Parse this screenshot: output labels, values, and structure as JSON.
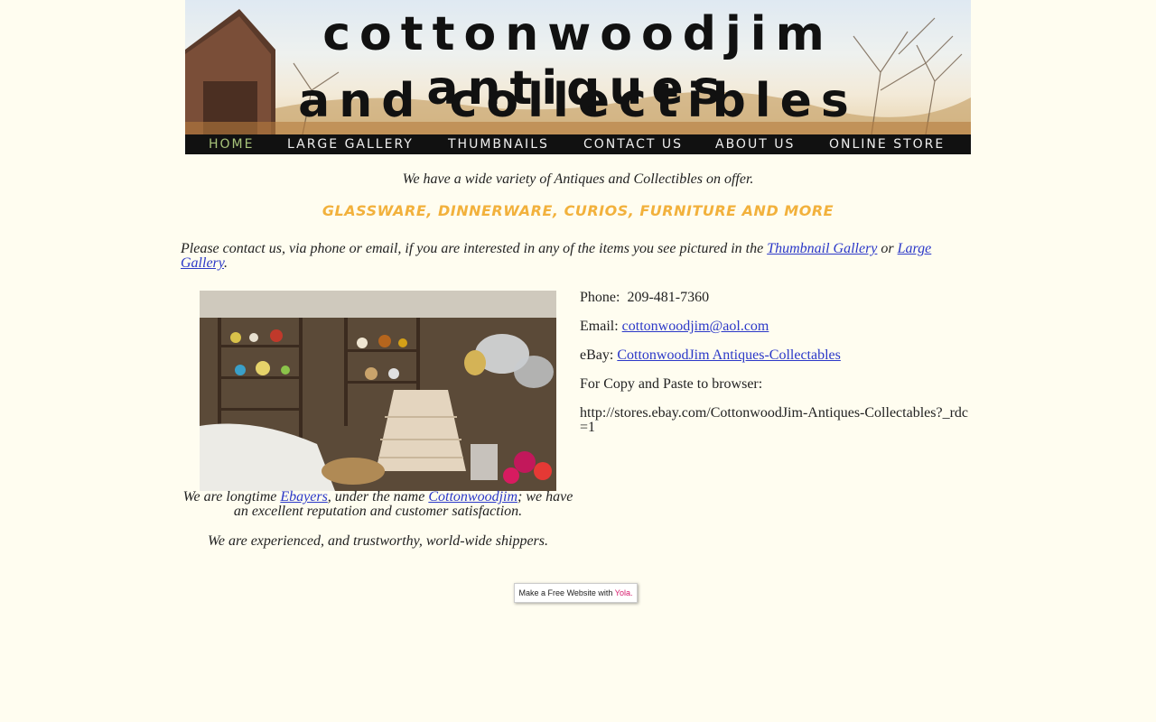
{
  "header": {
    "title_line1": "cottonwoodjim antiques",
    "title_line2": "and collectibles"
  },
  "nav": {
    "items": [
      {
        "label": "HOME",
        "active": true
      },
      {
        "label": "LARGE GALLERY",
        "active": false
      },
      {
        "label": "THUMBNAILS",
        "active": false
      },
      {
        "label": "CONTACT US",
        "active": false
      },
      {
        "label": "ABOUT US",
        "active": false
      },
      {
        "label": "ONLINE STORE",
        "active": false
      }
    ],
    "active_color": "#a8c47a"
  },
  "main": {
    "intro": "We have a wide variety of Antiques and Collectibles on offer.",
    "tagline": "GLASSWARE, DINNERWARE, CURIOS, FURNITURE AND MORE",
    "tagline_color": "#f2b13c",
    "contact_note": {
      "before": "Please contact us, via phone or email, if you are interested in any of the items you see pictured in the ",
      "link1": "Thumbnail Gallery",
      "middle": " or ",
      "link2": "Large Gallery",
      "after": "."
    },
    "caption": {
      "before": "We are longtime ",
      "link1": "Ebayers",
      "middle": ", under the name ",
      "link2": "Cottonwoodjim",
      "after": "; we have an excellent reputation and customer satisfaction."
    },
    "caption2": "We are experienced, and trustworthy, world-wide shippers."
  },
  "contact": {
    "phone_label": "Phone:",
    "phone": "209-481-7360",
    "email_label": "Email:",
    "email": "cottonwoodjim@aol.com",
    "ebay_label": "eBay:",
    "ebay_link": "CottonwoodJim Antiques-Collectables",
    "copy_label": "For Copy and Paste to browser:",
    "store_url": "http://stores.ebay.com/CottonwoodJim-Antiques-Collectables?_rdc=1"
  },
  "footer": {
    "badge_text": "Make a Free Website with ",
    "badge_brand": "Yola.",
    "brand_color": "#d7196b"
  }
}
